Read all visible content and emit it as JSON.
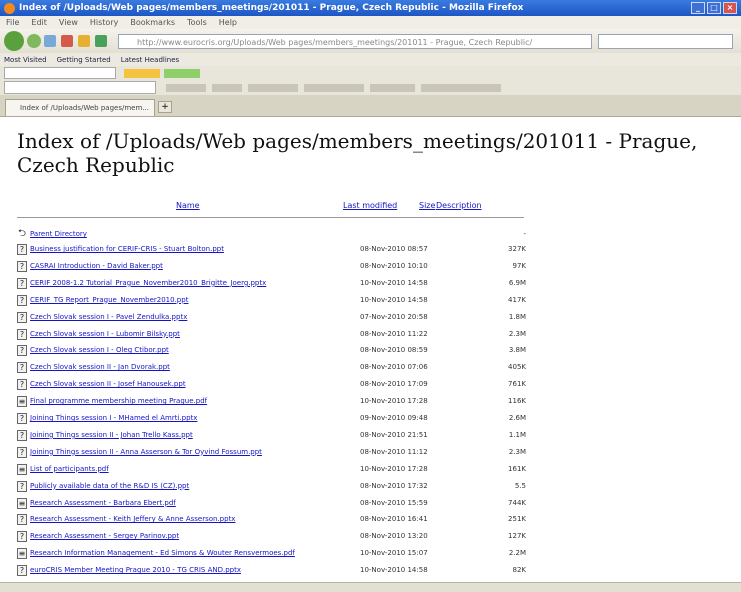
{
  "window": {
    "title": "Index of /Uploads/Web pages/members_meetings/201011 - Prague, Czech Republic - Mozilla Firefox"
  },
  "menubar": {
    "items": [
      "File",
      "Edit",
      "View",
      "History",
      "Bookmarks",
      "Tools",
      "Help"
    ]
  },
  "navbar": {
    "url": "http://www.eurocris.org/Uploads/Web pages/members_meetings/201011 - Prague, Czech Republic/"
  },
  "bookmarks": {
    "items": [
      "Most Visited",
      "Getting Started",
      "Latest Headlines"
    ]
  },
  "tab": {
    "label": "Index of /Uploads/Web pages/mem..."
  },
  "page": {
    "heading": "Index of /Uploads/Web pages/members_meetings/201011 - Prague, Czech Republic",
    "columns": {
      "name": "Name",
      "modified": "Last modified",
      "size": "Size",
      "description": "Description"
    },
    "parent": "Parent Directory",
    "parent_size": "-",
    "files": [
      {
        "name": "Business justification for CERIF-CRIS - Stuart Bolton.ppt",
        "date": "08-Nov-2010 08:57",
        "size": "327K",
        "icon": "ppt"
      },
      {
        "name": "CASRAI Introduction - David Baker.ppt",
        "date": "08-Nov-2010 10:10",
        "size": "97K",
        "icon": "ppt"
      },
      {
        "name": "CERIF 2008-1.2 Tutorial_Prague_November2010_Brigitte_Joerg.pptx",
        "date": "10-Nov-2010 14:58",
        "size": "6.9M",
        "icon": "ppt"
      },
      {
        "name": "CERIF_TG Report_Prague_November2010.ppt",
        "date": "10-Nov-2010 14:58",
        "size": "417K",
        "icon": "ppt"
      },
      {
        "name": "Czech Slovak session I - Pavel Zendulka.pptx",
        "date": "07-Nov-2010 20:58",
        "size": "1.8M",
        "icon": "ppt"
      },
      {
        "name": "Czech Slovak session I - Lubomir Bilsky.ppt",
        "date": "08-Nov-2010 11:22",
        "size": "2.3M",
        "icon": "ppt"
      },
      {
        "name": "Czech Slovak session I - Oleg Ctibor.ppt",
        "date": "08-Nov-2010 08:59",
        "size": "3.8M",
        "icon": "ppt"
      },
      {
        "name": "Czech Slovak session II - Jan Dvorak.ppt",
        "date": "08-Nov-2010 07:06",
        "size": "405K",
        "icon": "ppt"
      },
      {
        "name": "Czech Slovak session II - Josef Hanousek.ppt",
        "date": "08-Nov-2010 17:09",
        "size": "761K",
        "icon": "ppt"
      },
      {
        "name": "Final programme membership meeting Prague.pdf",
        "date": "10-Nov-2010 17:28",
        "size": "116K",
        "icon": "pdf"
      },
      {
        "name": "Joining Things session I - MHamed el Amrti.pptx",
        "date": "09-Nov-2010 09:48",
        "size": "2.6M",
        "icon": "ppt"
      },
      {
        "name": "Joining Things session II - Johan Trello Kass.ppt",
        "date": "08-Nov-2010 21:51",
        "size": "1.1M",
        "icon": "ppt"
      },
      {
        "name": "Joining Things session II - Anna Asserson & Tor Oyvind Fossum.ppt",
        "date": "08-Nov-2010 11:12",
        "size": "2.3M",
        "icon": "ppt"
      },
      {
        "name": "List of participants.pdf",
        "date": "10-Nov-2010 17:28",
        "size": "161K",
        "icon": "pdf"
      },
      {
        "name": "Publicly available data of the R&D IS (CZ).ppt",
        "date": "08-Nov-2010 17:32",
        "size": "5.5",
        "icon": "ppt"
      },
      {
        "name": "Research Assessment - Barbara Ebert.pdf",
        "date": "08-Nov-2010 15:59",
        "size": "744K",
        "icon": "pdf"
      },
      {
        "name": "Research Assessment - Keith Jeffery & Anne Asserson.pptx",
        "date": "08-Nov-2010 16:41",
        "size": "251K",
        "icon": "ppt"
      },
      {
        "name": "Research Assessment - Sergey Parinov.ppt",
        "date": "08-Nov-2010 13:20",
        "size": "127K",
        "icon": "ppt"
      },
      {
        "name": "Research Information Management - Ed Simons & Wouter Rensvermoes.pdf",
        "date": "10-Nov-2010 15:07",
        "size": "2.2M",
        "icon": "pdf"
      },
      {
        "name": "euroCRIS Member Meeting Prague 2010 - TG CRIS AND.pptx",
        "date": "10-Nov-2010 14:58",
        "size": "82K",
        "icon": "ppt"
      }
    ]
  },
  "colors": {
    "link": "#1515c8",
    "titlebar": "#1d56c4"
  }
}
